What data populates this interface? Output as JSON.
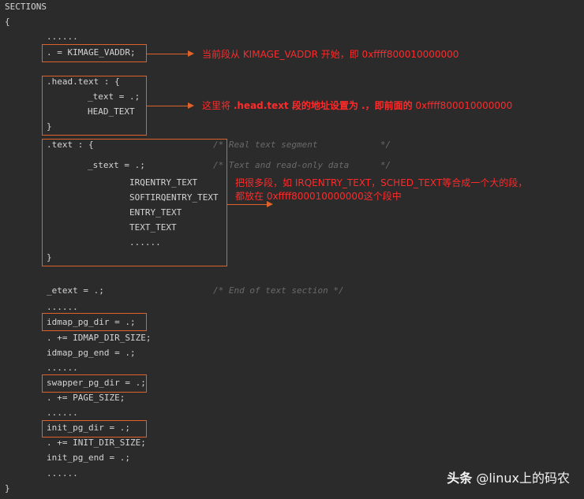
{
  "code": {
    "sections": "SECTIONS",
    "open_brace": "{",
    "dots": "......",
    "kimage": ". = KIMAGE_VADDR;",
    "head_text_open": ".head.text : {",
    "text_assign": "_text = .;",
    "head_text_macro": "HEAD_TEXT",
    "close_brace": "}",
    "text_open": ".text : {",
    "text_comment": "/* Real text segment            */",
    "stext": "_stext = .;",
    "stext_comment": "/* Text and read-only data      */",
    "irqentry": "IRQENTRY_TEXT",
    "softirqentry": "SOFTIRQENTRY_TEXT",
    "entry": "ENTRY_TEXT",
    "text_text": "TEXT_TEXT",
    "etext": "_etext = .;",
    "etext_comment": "/* End of text section */",
    "idmap_pg_dir": "idmap_pg_dir = .;",
    "idmap_size": ". += IDMAP_DIR_SIZE;",
    "idmap_pg_end": "idmap_pg_end = .;",
    "swapper_pg_dir": "swapper_pg_dir = .;",
    "page_size": ". += PAGE_SIZE;",
    "init_pg_dir": "init_pg_dir = .;",
    "init_size": ". += INIT_DIR_SIZE;",
    "init_pg_end": "init_pg_end = .;",
    "final_brace": "}"
  },
  "notes": {
    "note1": "当前段从 KIMAGE_VADDR 开始，即 0xffff800010000000",
    "note2_prefix": "这里将 ",
    "note2_bold": ".head.text 段的地址设置为 .，即前面的",
    "note2_suffix": " 0xffff800010000000",
    "note3_line1": "把很多段，如 IRQENTRY_TEXT，SCHED_TEXT等合成一个大的段，",
    "note3_line2": "都放在 0xffff800010000000这个段中"
  },
  "watermark": {
    "brand": "头条",
    "handle": " @linux上的码农"
  },
  "colors": {
    "background": "#2b2b2b",
    "box": "#e0622b",
    "note": "#ff2a2a"
  }
}
